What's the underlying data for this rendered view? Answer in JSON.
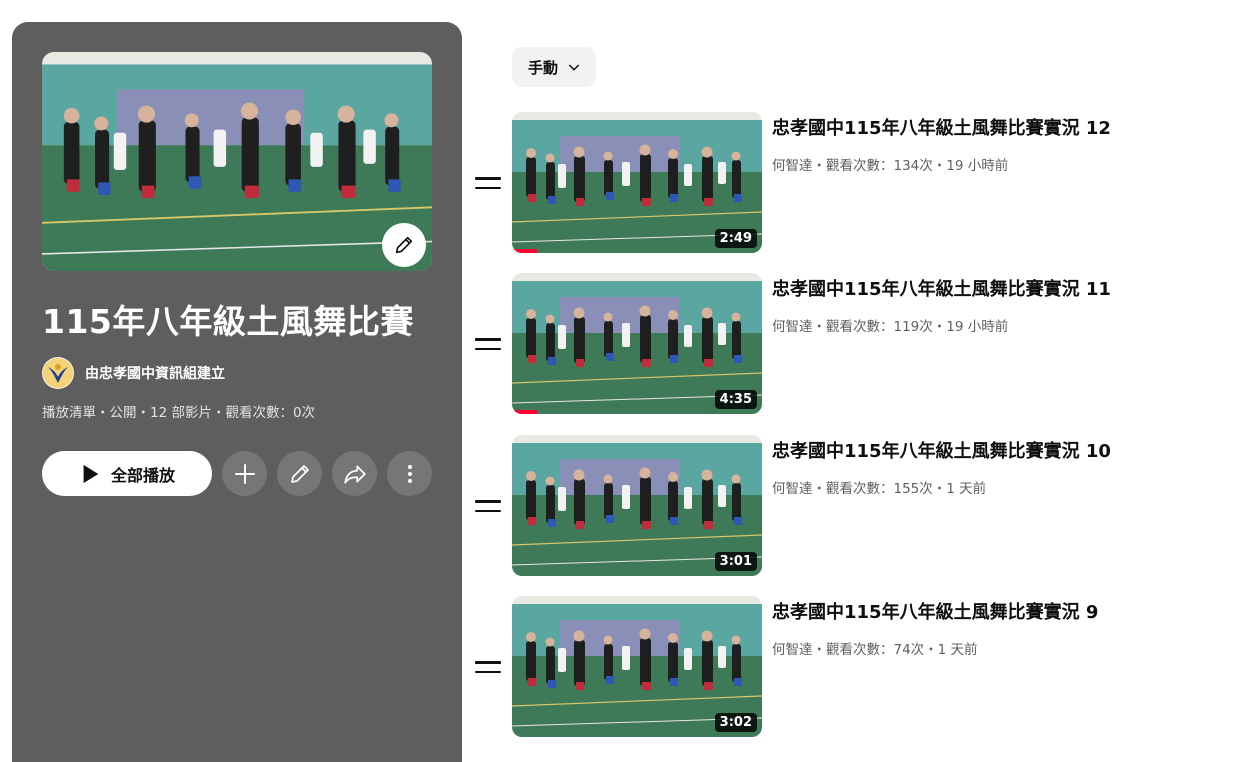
{
  "playlist": {
    "title": "115年八年級土風舞比賽",
    "owner": "由忠孝國中資訊組建立",
    "meta": "播放清單・公開・12 部影片・觀看次數：0次",
    "play_all_label": "全部播放",
    "cover_edit_icon": "pencil-icon"
  },
  "actions": {
    "add_icon": "plus-icon",
    "edit_icon": "pencil-icon",
    "share_icon": "share-icon",
    "more_icon": "more-vertical-icon"
  },
  "sort": {
    "label": "手動"
  },
  "videos": [
    {
      "title": "忠孝國中115年八年級土風舞比賽實況 12",
      "meta": "何智達・觀看次數：134次・19 小時前",
      "duration": "2:49",
      "watched_fraction": 0.1
    },
    {
      "title": "忠孝國中115年八年級土風舞比賽實況 11",
      "meta": "何智達・觀看次數：119次・19 小時前",
      "duration": "4:35",
      "watched_fraction": 0.1
    },
    {
      "title": "忠孝國中115年八年級土風舞比賽實況 10",
      "meta": "何智達・觀看次數：155次・1 天前",
      "duration": "3:01",
      "watched_fraction": 0
    },
    {
      "title": "忠孝國中115年八年級土風舞比賽實況 9",
      "meta": "何智達・觀看次數：74次・1 天前",
      "duration": "3:02",
      "watched_fraction": 0
    }
  ],
  "colors": {
    "panel": "#5e5e5e",
    "progress": "#ff0033",
    "floor": "#3f7a58",
    "curtain": "#5aa6a0"
  }
}
